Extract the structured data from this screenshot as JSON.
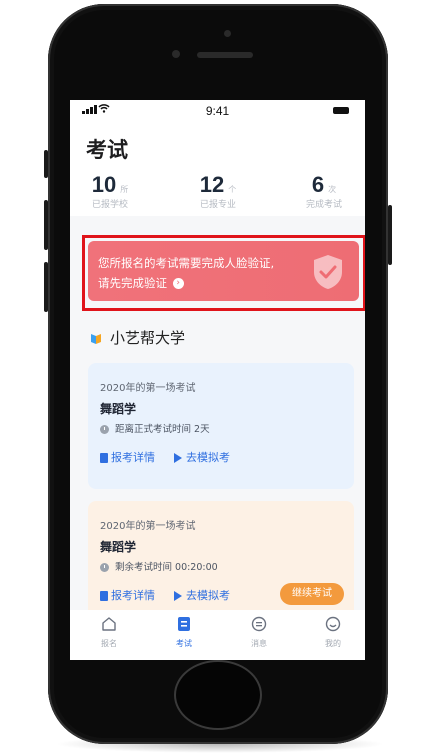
{
  "status_bar": {
    "time": "9:41"
  },
  "header": {
    "title": "考试",
    "stats": [
      {
        "value": "10",
        "unit": "所",
        "label": "已报学校"
      },
      {
        "value": "12",
        "unit": "个",
        "label": "已报专业"
      },
      {
        "value": "6",
        "unit": "次",
        "label": "完成考试"
      }
    ]
  },
  "alert": {
    "line1": "您所报名的考试需要完成人脸验证,",
    "line2": "请先完成验证",
    "icon": "shield-check-icon",
    "color": "#ef6d74",
    "highlight_color": "#e0141b"
  },
  "school": {
    "name": "小艺帮大学"
  },
  "exams": [
    {
      "title": "2020年的第一场考试",
      "subject": "舞蹈学",
      "info": "距离正式考试时间 2天",
      "details_link": "报考详情",
      "mock_link": "去模拟考"
    },
    {
      "title": "2020年的第一场考试",
      "subject": "舞蹈学",
      "info": "剩余考试时间 00:20:00",
      "details_link": "报考详情",
      "mock_link": "去模拟考",
      "continue_button": "继续考试"
    }
  ],
  "tabs": [
    {
      "label": "报名",
      "icon": "home-icon",
      "active": false
    },
    {
      "label": "考试",
      "icon": "exam-icon",
      "active": true
    },
    {
      "label": "消息",
      "icon": "message-icon",
      "active": false
    },
    {
      "label": "我的",
      "icon": "profile-icon",
      "active": false
    }
  ],
  "colors": {
    "accent": "#2f6fe0",
    "orange": "#f39a3d"
  }
}
